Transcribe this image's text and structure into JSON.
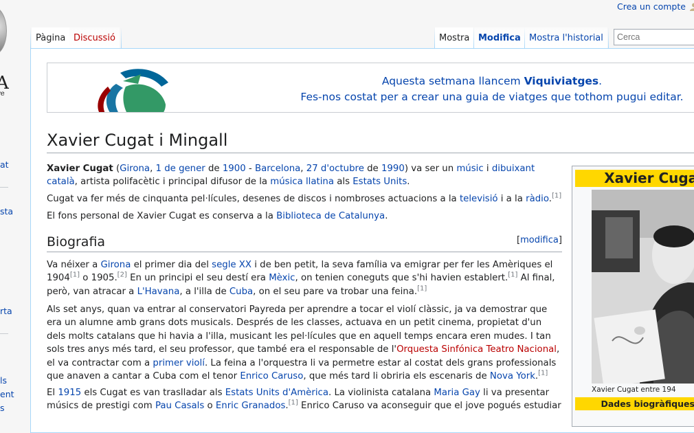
{
  "personal": {
    "create_account": "Crea un compte"
  },
  "logo": {
    "letter": "A",
    "sub": "re"
  },
  "left_column": [
    {
      "text": "at"
    },
    {
      "text": "sta"
    },
    {
      "text": "rta"
    },
    {
      "text": "ls"
    },
    {
      "text": "ent"
    },
    {
      "text": "s"
    }
  ],
  "tabs": {
    "page": "Pàgina",
    "discussion": "Discussió",
    "read": "Mostra",
    "edit": "Modifica",
    "history": "Mostra l'historial"
  },
  "search": {
    "placeholder": "Cerca"
  },
  "banner": {
    "line1_pre": "Aquesta setmana llancem ",
    "line1_bold": "Viquiviatges",
    "line1_post": ".",
    "line2": "Fes-nos costat per a crear una guia de viatges que tothom pugui editar."
  },
  "article": {
    "title": "Xavier Cugat i Mingall",
    "intro": {
      "name": "Xavier Cugat",
      "p1": "(",
      "girona": "Girona",
      "c1": ", ",
      "d1": "1 de gener",
      "de1": " de ",
      "y1": "1900",
      "dash": " - ",
      "barcelona": "Barcelona",
      "c2": ", ",
      "d2": "27 d'octubre",
      "de2": " de ",
      "y2": "1990",
      "t1": ") va ser un ",
      "music": "músic",
      "i": " i ",
      "dib": "dibuixant català",
      "t2": ", artista polifacètic i principal difusor de la ",
      "ml": "música llatina",
      "als": " als ",
      "eu": "Estats Units",
      "end": "."
    },
    "p2": {
      "t1": "Cugat va fer més de cinquanta pel·lícules, desenes de discos i nombroses actuacions a la ",
      "tv": "televisió",
      "t2": " i a la ",
      "radio": "ràdio",
      "t3": ".",
      "ref": "[1]"
    },
    "p3": {
      "t1": "El fons personal de Xavier Cugat es conserva a la ",
      "bib": "Biblioteca de Catalunya",
      "t2": "."
    },
    "section_bio": "Biografia",
    "edit_section_open": "[",
    "edit_section": "modifica",
    "edit_section_close": "]",
    "bio1": {
      "t1": "Va néixer a ",
      "girona": "Girona",
      "t2": " el primer dia del ",
      "segle": "segle XX",
      "t3": " i de ben petit, la seva família va emigrar per fer les Amèriques el 1904",
      "r1": "[1]",
      "t4": " o 1905.",
      "r2": "[2]",
      "t5": " En un principi el seu destí era ",
      "mexic": "Mèxic",
      "t6": ", on tenien coneguts que s'hi havien establert.",
      "r3": "[1]",
      "t7": " Al final, però, van atracar a ",
      "havana": "L'Havana",
      "t8": ", a l'illa de ",
      "cuba": "Cuba",
      "t9": ", on el seu pare va trobar una feina.",
      "r4": "[1]"
    },
    "bio2": {
      "t1": "Als set anys, quan va entrar al conservatori Payreda per aprendre a tocar el violí clàssic, ja va demostrar que era un alumne amb grans dots musicals. Després de les classes, actuava en un petit cinema, propietat d'un dels molts catalans que hi havia a l'illa, musicant les pel·lícules que en aquell temps encara eren mudes. I tan sols tres anys més tard, el seu professor, que també era el responsable de l'",
      "orq": "Orquesta Sinfónica Teatro Nacional",
      "t2": ", el va contractar com a ",
      "violi": "primer violí",
      "t3": ". La feina a l'orquestra li va permetre estar al costat dels grans professionals que anaven a cantar a Cuba com el tenor ",
      "caruso": "Enrico Caruso",
      "t4": ", que més tard li obriria els escenaris de ",
      "ny": "Nova York",
      "t5": ".",
      "ref": "[1]"
    },
    "bio3": {
      "t1": "El ",
      "y1915": "1915",
      "t2": " els Cugat es van traslladar als ",
      "eua": "Estats Units d'Amèrica",
      "t3": ". La violinista catalana ",
      "mg": "Maria Gay",
      "t4": " li va presentar músics de prestigi com ",
      "pc": "Pau Casals",
      "o": " o ",
      "eg": "Enric Granados",
      "t5": ".",
      "ref": "[1]",
      "t6": " Enrico Caruso va aconseguir que el jove pogués estudiar"
    }
  },
  "infobox": {
    "title": "Xavier Cugat",
    "caption": "Xavier Cugat entre 194",
    "subheader": "Dades biogràfiques i"
  }
}
